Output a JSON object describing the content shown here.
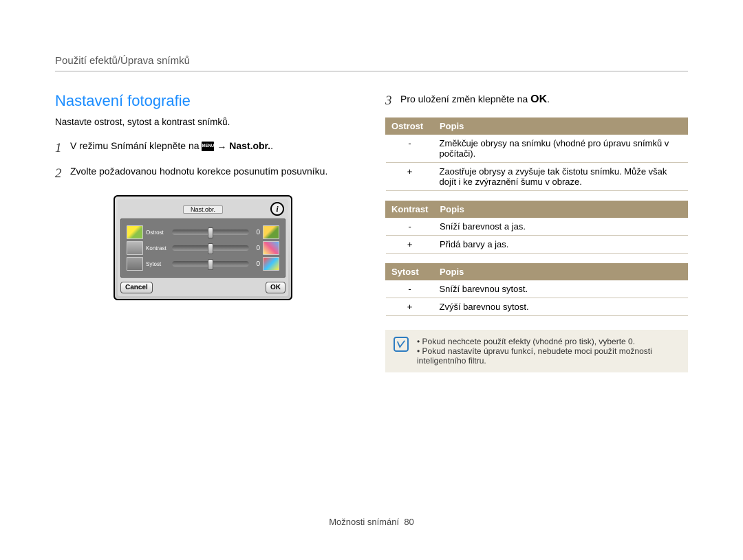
{
  "breadcrumb": "Použití efektů/Úprava snímků",
  "title": "Nastavení fotografie",
  "subtitle": "Nastavte ostrost, sytost a kontrast snímků.",
  "steps": {
    "s1_pre": "V režimu Snímání klepněte na ",
    "s1_arrow": " → ",
    "s1_bold": "Nast.obr.",
    "s1_end": ".",
    "s2": "Zvolte požadovanou hodnotu korekce posunutím posuvníku.",
    "s3_pre": "Pro uložení změn klepněte na ",
    "s3_end": "."
  },
  "step_numbers": {
    "n1": "1",
    "n2": "2",
    "n3": "3"
  },
  "menu_label": "MENU",
  "ok_char": "",
  "camera": {
    "title": "Nast.obr.",
    "rows": [
      {
        "label": "Ostrost",
        "value": "0"
      },
      {
        "label": "Kontrast",
        "value": "0"
      },
      {
        "label": "Sytost",
        "value": "0"
      }
    ],
    "cancel": "Cancel",
    "ok": "OK"
  },
  "tables": [
    {
      "headers": [
        "Ostrost",
        "Popis"
      ],
      "rows": [
        {
          "k": "-",
          "v": "Změkčuje obrysy na snímku (vhodné pro úpravu snímků v počítači)."
        },
        {
          "k": "+",
          "v": "Zaostřuje obrysy a zvyšuje tak čistotu snímku. Může však dojít i ke zvýraznění šumu v obraze."
        }
      ]
    },
    {
      "headers": [
        "Kontrast",
        "Popis"
      ],
      "rows": [
        {
          "k": "-",
          "v": "Sníží barevnost a jas."
        },
        {
          "k": "+",
          "v": "Přidá barvy a jas."
        }
      ]
    },
    {
      "headers": [
        "Sytost",
        "Popis"
      ],
      "rows": [
        {
          "k": "-",
          "v": "Sníží barevnou sytost."
        },
        {
          "k": "+",
          "v": "Zvýší barevnou sytost."
        }
      ]
    }
  ],
  "notes": [
    "Pokud nechcete použít efekty (vhodné pro tisk), vyberte 0.",
    "Pokud nastavíte úpravu funkcí, nebudete moci použít možnosti inteligentního filtru."
  ],
  "footer_label": "Možnosti snímání",
  "footer_page": "80"
}
